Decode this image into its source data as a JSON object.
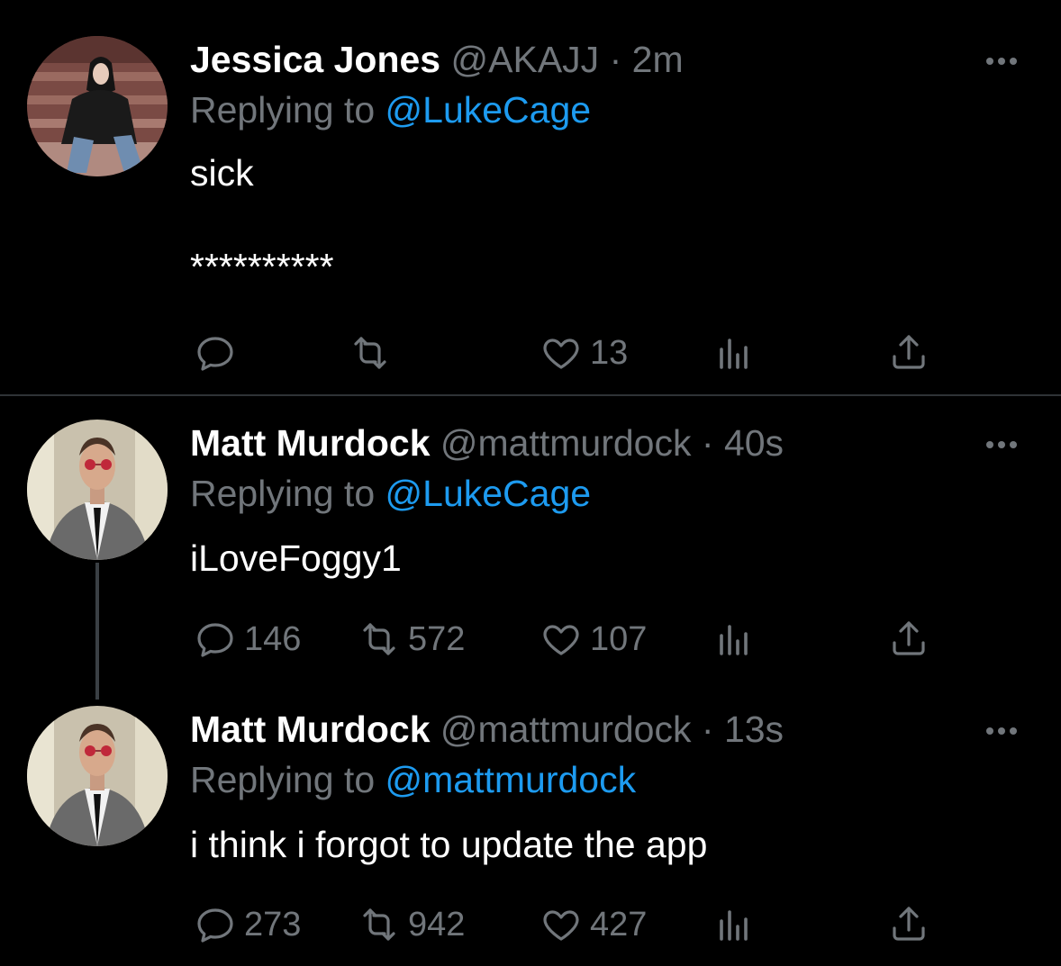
{
  "tweets": [
    {
      "name": "Jessica Jones",
      "handle": "@AKAJJ",
      "sep": "·",
      "time": "2m",
      "replying_prefix": "Replying to",
      "replying_to": "@LukeCage",
      "text": "sick\n\n**********",
      "replies": "",
      "retweets": "",
      "likes": "13"
    },
    {
      "name": "Matt Murdock",
      "handle": "@mattmurdock",
      "sep": "·",
      "time": "40s",
      "replying_prefix": "Replying to",
      "replying_to": "@LukeCage",
      "text": "iLoveFoggy1",
      "replies": "146",
      "retweets": "572",
      "likes": "107"
    },
    {
      "name": "Matt Murdock",
      "handle": "@mattmurdock",
      "sep": "·",
      "time": "13s",
      "replying_prefix": "Replying to",
      "replying_to": "@mattmurdock",
      "text": "i think i forgot to update the app",
      "replies": "273",
      "retweets": "942",
      "likes": "427"
    }
  ],
  "icons": {
    "reply": "reply-icon",
    "retweet": "retweet-icon",
    "like": "heart-icon",
    "views": "views-icon",
    "share": "share-icon",
    "more": "more-icon"
  },
  "colors": {
    "background": "#000000",
    "secondary_text": "#71767b",
    "mention": "#1d9bf0",
    "divider": "#2f3336"
  }
}
